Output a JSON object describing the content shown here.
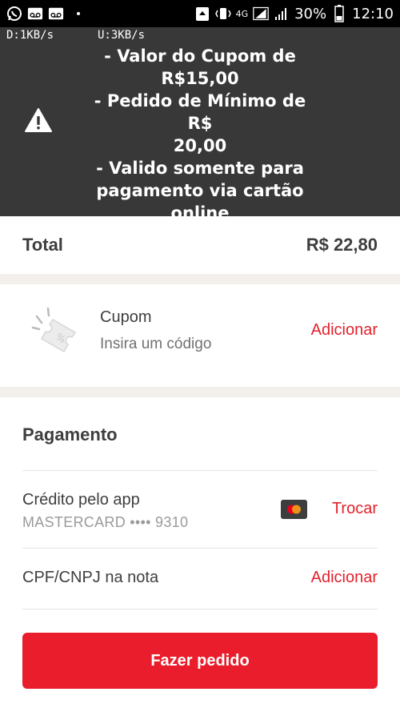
{
  "status_bar": {
    "battery_percent": "30%",
    "time": "12:10",
    "network": "4G"
  },
  "net_speed": {
    "download": "D:1KB/s",
    "upload": "U:3KB/s"
  },
  "toast": {
    "icon": "warning-icon",
    "lines": [
      "- Valor do Cupom de",
      "R$15,00",
      "- Pedido de Mínimo de R$",
      "20,00",
      "- Valido somente para",
      "pagamento via cartão",
      "online"
    ]
  },
  "total": {
    "label": "Total",
    "value": "R$ 22,80"
  },
  "coupon": {
    "icon": "coupon-ticket-icon",
    "title": "Cupom",
    "subtitle": "Insira um código",
    "action": "Adicionar"
  },
  "payment": {
    "title": "Pagamento",
    "method_label": "Crédito pelo app",
    "card_info": "MASTERCARD •••• 9310",
    "card_icon": "mastercard-icon",
    "change_action": "Trocar",
    "cpf_label": "CPF/CNPJ na nota",
    "cpf_action": "Adicionar"
  },
  "cta": {
    "label": "Fazer pedido"
  },
  "colors": {
    "accent": "#ea1d2c",
    "link": "#e3222d",
    "toast_bg": "#383838",
    "divider": "#f3efeb"
  }
}
